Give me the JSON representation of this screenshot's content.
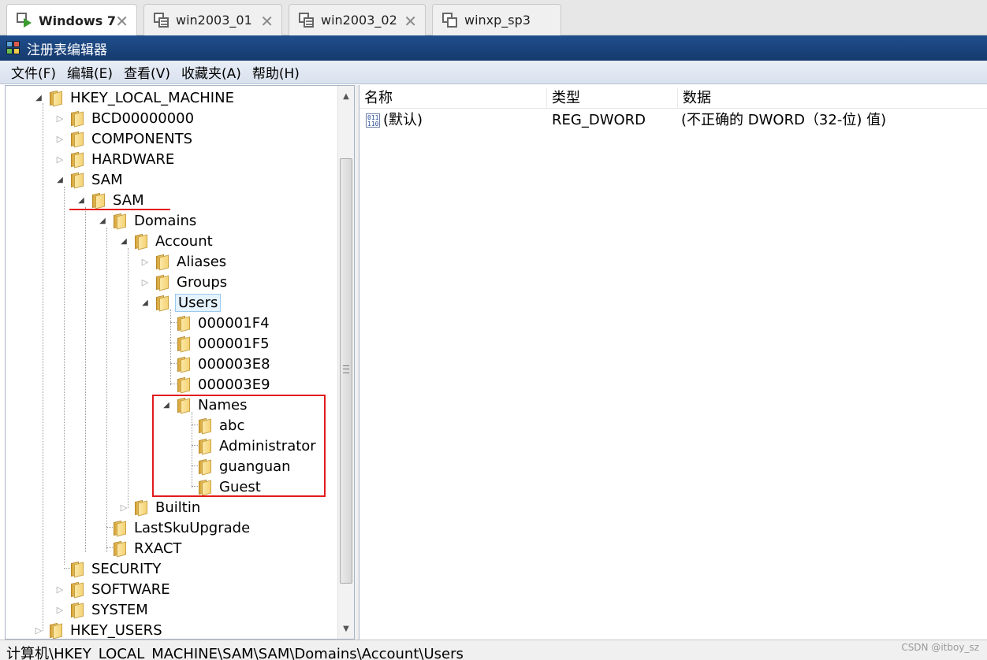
{
  "vm_tabs": [
    {
      "label": "Windows 7",
      "active": true,
      "icon": "vm-running-icon"
    },
    {
      "label": "win2003_01",
      "active": false,
      "icon": "vm-icon"
    },
    {
      "label": "win2003_02",
      "active": false,
      "icon": "vm-icon"
    },
    {
      "label": "winxp_sp3",
      "active": false,
      "icon": "vm-icon"
    }
  ],
  "window": {
    "title": "注册表编辑器",
    "icon": "regedit-icon"
  },
  "menu": [
    "文件(F)",
    "编辑(E)",
    "查看(V)",
    "收藏夹(A)",
    "帮助(H)"
  ],
  "tree": [
    {
      "label": "HKEY_LOCAL_MACHINE",
      "expanded": true
    },
    {
      "label": "BCD00000000",
      "expanded": false
    },
    {
      "label": "COMPONENTS",
      "expanded": false
    },
    {
      "label": "HARDWARE",
      "expanded": false
    },
    {
      "label": "SAM",
      "expanded": true
    },
    {
      "label": "SAM",
      "expanded": true
    },
    {
      "label": "Domains",
      "expanded": true
    },
    {
      "label": "Account",
      "expanded": true
    },
    {
      "label": "Aliases",
      "expanded": false
    },
    {
      "label": "Groups",
      "expanded": false
    },
    {
      "label": "Users",
      "expanded": true,
      "selected": true
    },
    {
      "label": "000001F4"
    },
    {
      "label": "000001F5"
    },
    {
      "label": "000003E8"
    },
    {
      "label": "000003E9"
    },
    {
      "label": "Names",
      "expanded": true
    },
    {
      "label": "abc"
    },
    {
      "label": "Administrator"
    },
    {
      "label": "guanguan"
    },
    {
      "label": "Guest"
    },
    {
      "label": "Builtin",
      "expanded": false
    },
    {
      "label": "LastSkuUpgrade"
    },
    {
      "label": "RXACT"
    },
    {
      "label": "SECURITY"
    },
    {
      "label": "SOFTWARE",
      "expanded": false
    },
    {
      "label": "SYSTEM",
      "expanded": false
    },
    {
      "label": "HKEY_USERS",
      "expanded": false
    }
  ],
  "list": {
    "columns": [
      "名称",
      "类型",
      "数据"
    ],
    "rows": [
      {
        "name": "(默认)",
        "type": "REG_DWORD",
        "data": "(不正确的 DWORD（32-位) 值)"
      }
    ]
  },
  "status": {
    "path": "计算机\\HKEY_LOCAL_MACHINE\\SAM\\SAM\\Domains\\Account\\Users"
  },
  "watermark": "CSDN @itboy_sz",
  "colors": {
    "annotation": "#e21b1b",
    "titlebar": "#1f4e8c"
  }
}
